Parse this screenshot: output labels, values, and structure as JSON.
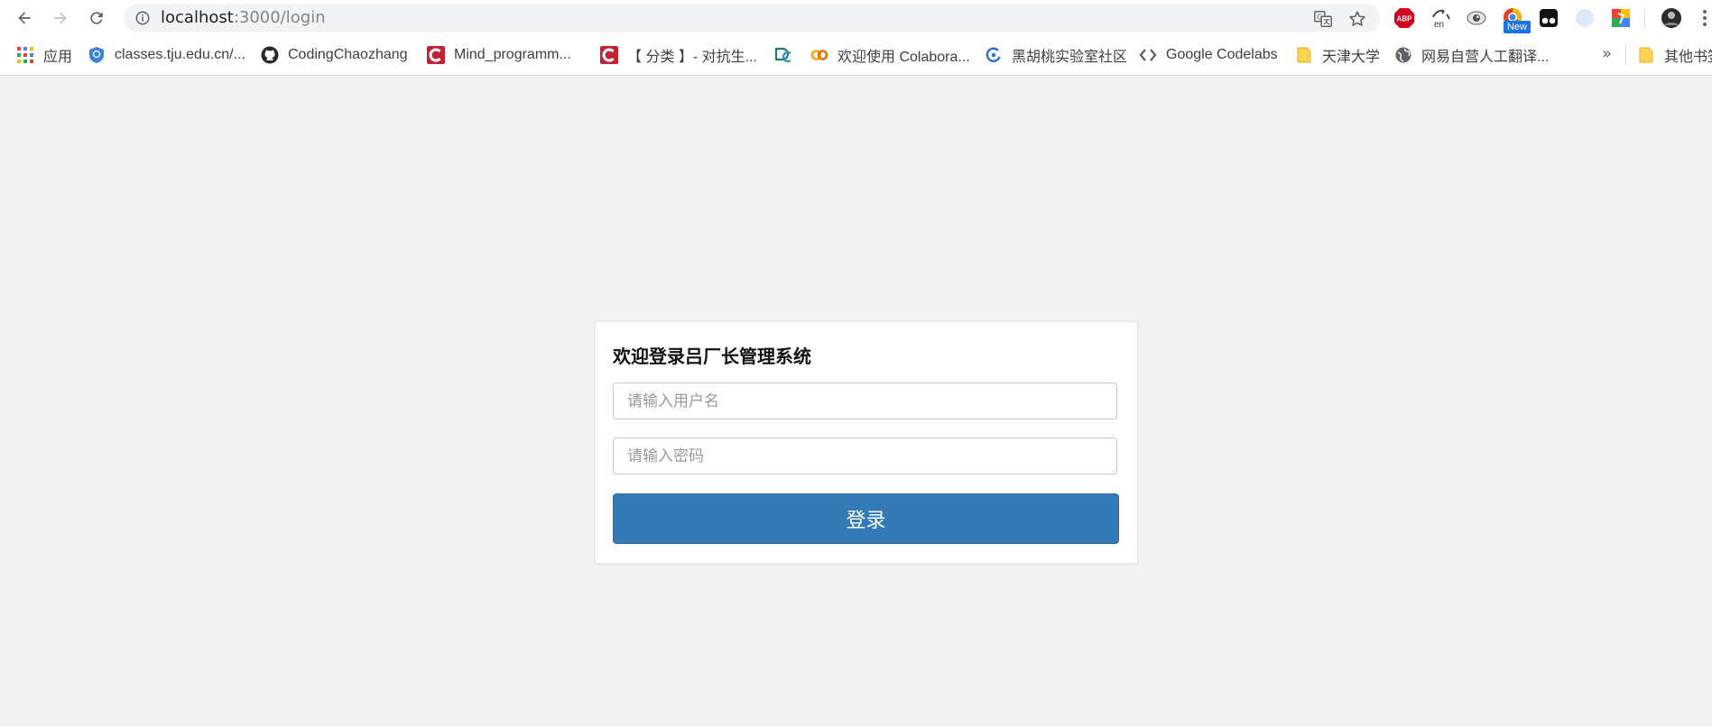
{
  "browser": {
    "url_host": "localhost",
    "url_path": ":3000/login",
    "icons": {
      "back": "back-arrow-icon",
      "forward": "forward-arrow-icon",
      "reload": "reload-icon",
      "info": "info-icon",
      "translate": "translate-icon",
      "bookmark_star": "star-icon",
      "menu": "more-vert-icon"
    },
    "extensions": [
      {
        "name": "abp-extension-icon",
        "label": "ABP",
        "color": "#d0021b"
      },
      {
        "name": "en-translate-extension-icon",
        "label": "en",
        "color": "#333333"
      },
      {
        "name": "eye-extension-icon",
        "color": "#555555"
      },
      {
        "name": "chrome-new-extension-icon",
        "badge": "New",
        "color": "#1a73e8"
      },
      {
        "name": "tampermonkey-extension-icon",
        "color": "#000000"
      },
      {
        "name": "blue-moon-extension-icon",
        "color": "#4a7fd6"
      },
      {
        "name": "multicolor-extension-icon",
        "color": "#4caf50"
      },
      {
        "name": "profile-avatar-icon",
        "color": "#2b2b2b"
      }
    ]
  },
  "bookmarks": [
    {
      "label": "应用",
      "icon": "apps-grid-icon"
    },
    {
      "label": "classes.tju.edu.cn/...",
      "icon": "tju-shield-icon"
    },
    {
      "label": "CodingChaozhang",
      "icon": "github-icon"
    },
    {
      "label": "Mind_programm...",
      "icon": "csdn-icon"
    },
    {
      "label": "【 分类 】- 对抗生...",
      "icon": "csdn-icon"
    },
    {
      "label": "",
      "icon": "dc-icon"
    },
    {
      "label": "欢迎使用 Colabora...",
      "icon": "colab-icon"
    },
    {
      "label": "黑胡桃实验室社区",
      "icon": "swirl-icon"
    },
    {
      "label": "Google Codelabs",
      "icon": "code-brackets-icon"
    },
    {
      "label": "天津大学",
      "icon": "folder-icon"
    },
    {
      "label": "网易自营人工翻译...",
      "icon": "globe-icon"
    },
    {
      "label": "其他书签",
      "icon": "folder-icon"
    }
  ],
  "bookmarks_more": "»",
  "login": {
    "title": "欢迎登录吕厂长管理系统",
    "username_placeholder": "请输入用户名",
    "username_value": "",
    "password_placeholder": "请输入密码",
    "password_value": "",
    "submit_label": "登录",
    "accent_color": "#337ab7"
  }
}
